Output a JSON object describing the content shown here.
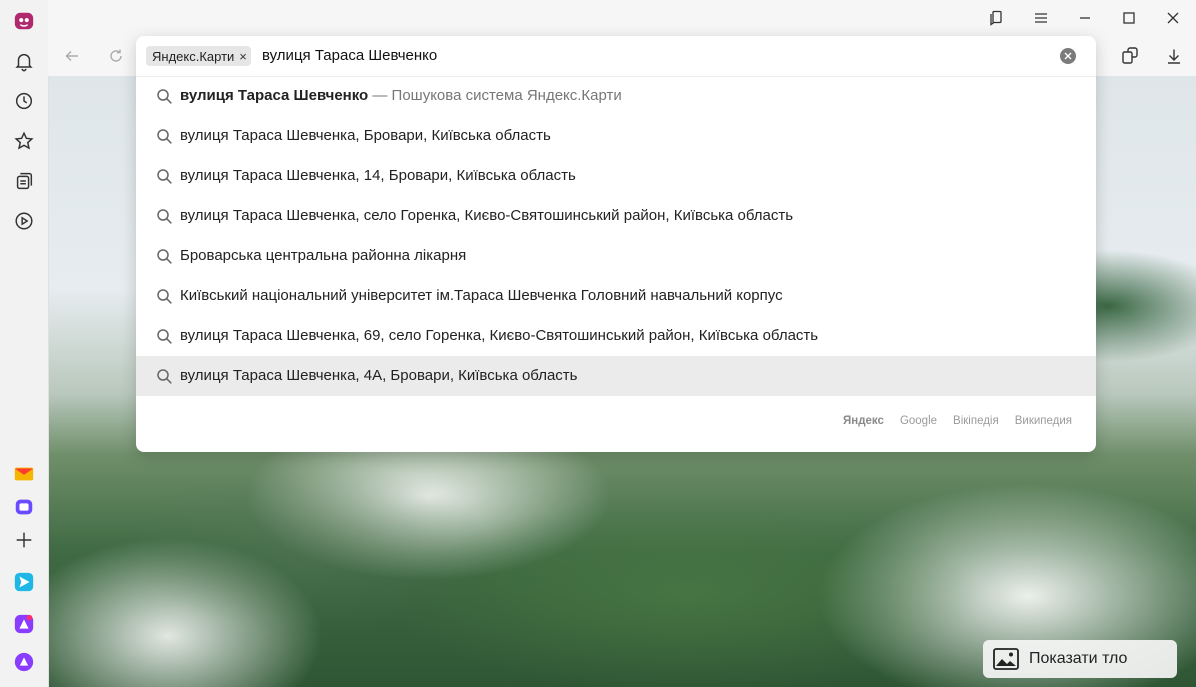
{
  "omnibox": {
    "chip_label": "Яндекс.Карти",
    "chip_close": "×",
    "query": "вулиця Тараса Шевченко"
  },
  "suggestions": [
    {
      "bold": "вулиця Тараса Шевченко",
      "hint": " — Пошукова система Яндекс.Карти"
    },
    {
      "text": "вулиця Тараса Шевченка, Бровари, Київська область"
    },
    {
      "text": "вулиця Тараса Шевченка, 14, Бровари, Київська область"
    },
    {
      "text": "вулиця Тараса Шевченка, село Горенка, Києво-Святошинський район, Київська область"
    },
    {
      "text": "Броварська центральна районна лікарня"
    },
    {
      "text": "Київський національний університет ім.Тараса Шевченка Головний навчальний корпус"
    },
    {
      "text": "вулиця Тараса Шевченка, 69, село Горенка, Києво-Святошинський район, Київська область"
    },
    {
      "text": "вулиця Тараса Шевченка, 4А, Бровари, Київська область",
      "selected": true
    }
  ],
  "search_engines": [
    "Яндекс",
    "Google",
    "Вікіпедія",
    "Википедия"
  ],
  "show_background_label": "Показати тло",
  "icons": {
    "sidebar": [
      "browser-logo-icon",
      "bell-icon",
      "history-icon",
      "star-icon",
      "collections-icon",
      "video-icon",
      "mail-icon",
      "messenger-icon",
      "add-icon",
      "send-icon",
      "market-icon",
      "alice-icon"
    ],
    "titlebar": [
      "bookmarks-icon",
      "menu-icon",
      "minimize-icon",
      "maximize-icon",
      "close-icon"
    ],
    "toolbar": [
      "back-icon",
      "reload-icon",
      "extensions-icon",
      "download-icon"
    ]
  },
  "colors": {
    "accent_mail": "#f5b400",
    "accent_messenger": "#6b4bff",
    "accent_alice": "#8a3cff"
  }
}
